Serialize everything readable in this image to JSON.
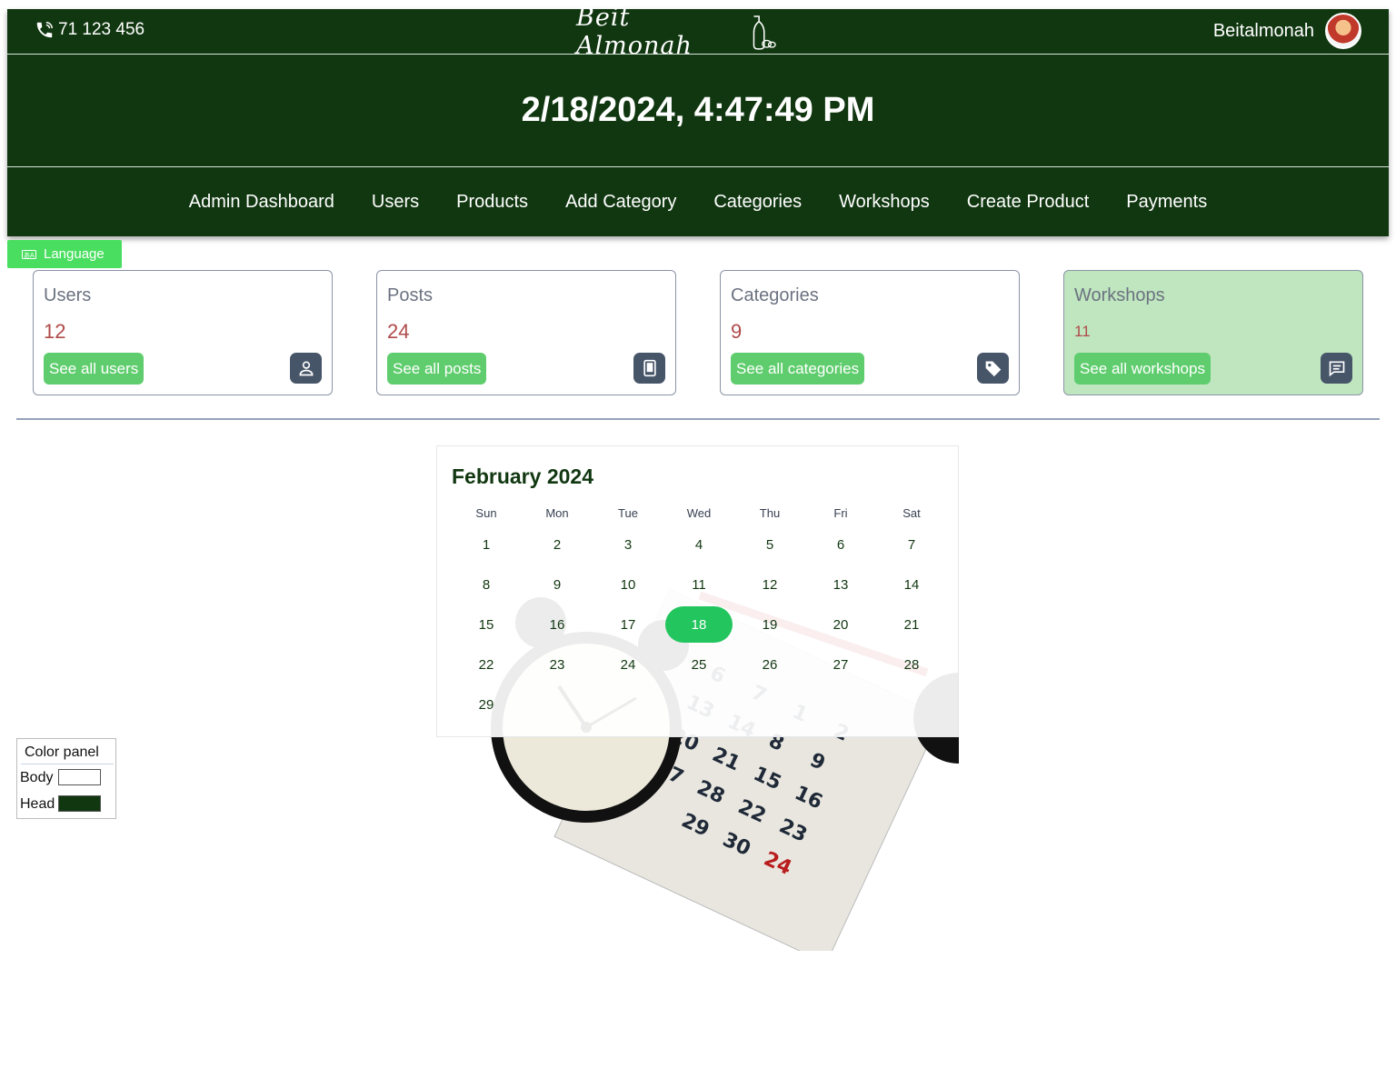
{
  "header": {
    "phone": "71 123 456",
    "logo_text": "Beit Almonah",
    "username": "Beitalmonah",
    "datetime": "2/18/2024, 4:47:49 PM",
    "bg_color": "#113711"
  },
  "nav": {
    "items": [
      "Admin Dashboard",
      "Users",
      "Products",
      "Add Category",
      "Categories",
      "Workshops",
      "Create Product",
      "Payments"
    ]
  },
  "language_button": "Language",
  "cards": [
    {
      "title": "Users",
      "count": "12",
      "button": "See all users",
      "icon": "user-icon"
    },
    {
      "title": "Posts",
      "count": "24",
      "button": "See all posts",
      "icon": "tablet-icon"
    },
    {
      "title": "Categories",
      "count": "9",
      "button": "See all categories",
      "icon": "tag-icon"
    },
    {
      "title": "Workshops",
      "count": "11",
      "button": "See all workshops",
      "icon": "message-icon"
    }
  ],
  "calendar": {
    "month_title": "February 2024",
    "weekdays": [
      "Sun",
      "Mon",
      "Tue",
      "Wed",
      "Thu",
      "Fri",
      "Sat"
    ],
    "days": [
      "1",
      "2",
      "3",
      "4",
      "5",
      "6",
      "7",
      "8",
      "9",
      "10",
      "11",
      "12",
      "13",
      "14",
      "15",
      "16",
      "17",
      "18",
      "19",
      "20",
      "21",
      "22",
      "23",
      "24",
      "25",
      "26",
      "27",
      "28",
      "29"
    ],
    "selected_day": "18"
  },
  "color_panel": {
    "title": "Color panel",
    "body_label": "Body",
    "head_label": "Head",
    "body_color": "#ffffff",
    "head_color": "#113711"
  }
}
